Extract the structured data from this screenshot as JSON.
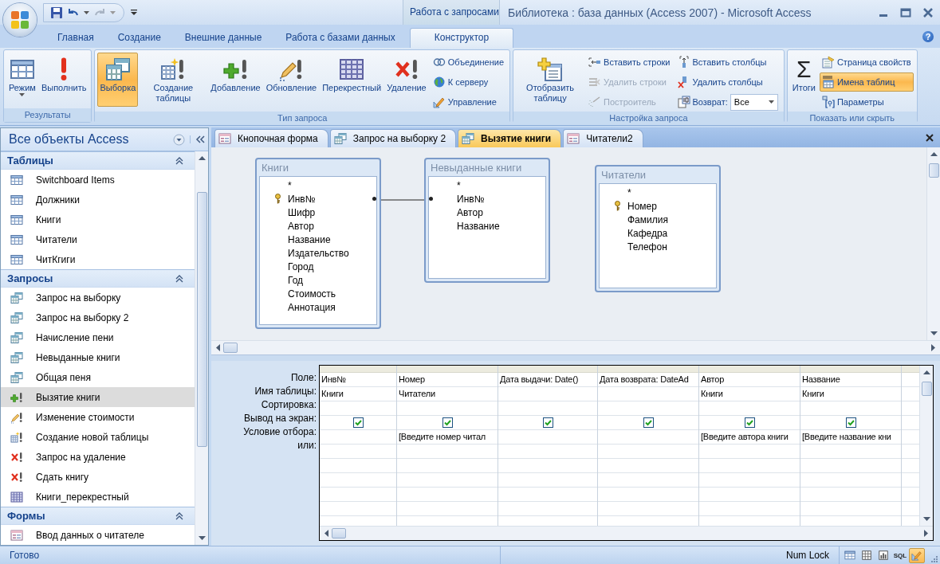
{
  "window": {
    "title": "Библиотека : база данных (Access 2007) - Microsoft Access",
    "context_tab_group": "Работа с запросами",
    "help_symbol": "?"
  },
  "ribbon_tabs": [
    {
      "label": "Главная",
      "selected": false
    },
    {
      "label": "Создание",
      "selected": false
    },
    {
      "label": "Внешние данные",
      "selected": false
    },
    {
      "label": "Работа с базами данных",
      "selected": false
    },
    {
      "label": "Конструктор",
      "selected": true
    }
  ],
  "ribbon_groups": [
    {
      "label": "Результаты",
      "items": [
        {
          "kind": "large",
          "label": "Режим",
          "dropdown": true
        },
        {
          "kind": "large",
          "label": "Выполнить"
        }
      ]
    },
    {
      "label": "Тип запроса",
      "items": [
        {
          "kind": "large",
          "label": "Выборка",
          "selected": true
        },
        {
          "kind": "large",
          "label": "Создание таблицы",
          "selected": false
        },
        {
          "kind": "large",
          "label": "Добавление",
          "selected": false
        },
        {
          "kind": "large",
          "label": "Обновление",
          "selected": false
        },
        {
          "kind": "large",
          "label": "Перекрестный",
          "selected": false
        },
        {
          "kind": "large",
          "label": "Удаление",
          "selected": false
        },
        {
          "kind": "small",
          "label": "Объединение",
          "selected": false
        },
        {
          "kind": "small",
          "label": "К серверу",
          "selected": false
        },
        {
          "kind": "small",
          "label": "Управление",
          "selected": false
        }
      ]
    },
    {
      "label": "Настройка запроса",
      "items": [
        {
          "kind": "large",
          "label": "Отобразить таблицу",
          "disabled": false
        },
        {
          "kind": "small",
          "label": "Вставить строки",
          "disabled": false
        },
        {
          "kind": "small",
          "label": "Удалить строки",
          "disabled": true
        },
        {
          "kind": "small",
          "label": "Построитель",
          "disabled": true
        },
        {
          "kind": "small",
          "label": "Вставить столбцы",
          "disabled": false
        },
        {
          "kind": "small",
          "label": "Удалить столбцы",
          "disabled": false
        },
        {
          "kind": "combo",
          "label": "Возврат:",
          "value": "Все",
          "disabled": false
        }
      ]
    },
    {
      "label": "Показать или скрыть",
      "items": [
        {
          "kind": "large",
          "label": "Итоги",
          "symbol": "Σ",
          "on": false
        },
        {
          "kind": "small",
          "label": "Страница свойств",
          "on": false
        },
        {
          "kind": "small",
          "label": "Имена таблиц",
          "on": true
        },
        {
          "kind": "small",
          "label": "Параметры",
          "on": false
        }
      ]
    }
  ],
  "nav_pane": {
    "title": "Все объекты Access",
    "groups": [
      {
        "label": "Таблицы",
        "expanded": true,
        "items": [
          {
            "kind": "table",
            "label": "Switchboard Items",
            "selected": false
          },
          {
            "kind": "table",
            "label": "Должники",
            "selected": false
          },
          {
            "kind": "table",
            "label": "Книги",
            "selected": false
          },
          {
            "kind": "table",
            "label": "Читатели",
            "selected": false
          },
          {
            "kind": "table",
            "label": "ЧитКгиги",
            "selected": false
          }
        ]
      },
      {
        "label": "Запросы",
        "expanded": true,
        "items": [
          {
            "kind": "select",
            "label": "Запрос на выборку",
            "selected": false
          },
          {
            "kind": "select",
            "label": "Запрос на выборку 2",
            "selected": false
          },
          {
            "kind": "select",
            "label": "Начисление пени",
            "selected": false
          },
          {
            "kind": "select",
            "label": "Невыданные книги",
            "selected": false
          },
          {
            "kind": "select",
            "label": "Общая пеня",
            "selected": false
          },
          {
            "kind": "append",
            "label": "Вызятие книги",
            "selected": true
          },
          {
            "kind": "update",
            "label": "Изменение стоимости",
            "selected": false
          },
          {
            "kind": "maketable",
            "label": "Создание новой таблицы",
            "selected": false
          },
          {
            "kind": "delete",
            "label": "Запрос на удаление",
            "selected": false
          },
          {
            "kind": "delete",
            "label": "Сдать книгу",
            "selected": false
          },
          {
            "kind": "crosstab",
            "label": "Книги_перекрестный",
            "selected": false
          }
        ]
      },
      {
        "label": "Формы",
        "expanded": true,
        "items": [
          {
            "kind": "form",
            "label": "Ввод данных о читателе",
            "selected": false
          }
        ]
      }
    ]
  },
  "document_tabs": [
    {
      "kind": "form",
      "label": "Кнопочная форма",
      "selected": false
    },
    {
      "kind": "query",
      "label": "Запрос на выборку 2",
      "selected": false
    },
    {
      "kind": "query",
      "label": "Вызятие книги",
      "selected": true
    },
    {
      "kind": "form",
      "label": "Читатели2",
      "selected": false
    }
  ],
  "query_tables": [
    {
      "title": "Книги",
      "fields": [
        {
          "name": "*",
          "key": false,
          "join": false
        },
        {
          "name": "Инв№",
          "key": true,
          "join": true
        },
        {
          "name": "Шифр",
          "key": false,
          "join": false
        },
        {
          "name": "Автор",
          "key": false,
          "join": false
        },
        {
          "name": "Название",
          "key": false,
          "join": false
        },
        {
          "name": "Издательство",
          "key": false,
          "join": false
        },
        {
          "name": "Город",
          "key": false,
          "join": false
        },
        {
          "name": "Год",
          "key": false,
          "join": false
        },
        {
          "name": "Стоимость",
          "key": false,
          "join": false
        },
        {
          "name": "Аннотация",
          "key": false,
          "join": false
        }
      ]
    },
    {
      "title": "Невыданные книги",
      "fields": [
        {
          "name": "*",
          "key": false,
          "join": false
        },
        {
          "name": "Инв№",
          "key": false,
          "join": true
        },
        {
          "name": "Автор",
          "key": false,
          "join": false
        },
        {
          "name": "Название",
          "key": false,
          "join": false
        }
      ]
    },
    {
      "title": "Читатели",
      "fields": [
        {
          "name": "*",
          "key": false,
          "join": false
        },
        {
          "name": "Номер",
          "key": true,
          "join": false
        },
        {
          "name": "Фамилия",
          "key": false,
          "join": false
        },
        {
          "name": "Кафедра",
          "key": false,
          "join": false
        },
        {
          "name": "Телефон",
          "key": false,
          "join": false
        }
      ]
    }
  ],
  "design_grid": {
    "row_labels": [
      "Поле:",
      "Имя таблицы:",
      "Сортировка:",
      "Вывод на экран:",
      "Условие отбора:",
      "или:"
    ],
    "columns": [
      {
        "field": "Инв№",
        "table": "Книги",
        "show": true
      },
      {
        "field": "Номер",
        "table": "Читатели",
        "show": true,
        "criteria": "[Введите номер читал"
      },
      {
        "field": "Дата выдачи: Date()",
        "show": true
      },
      {
        "field": "Дата возврата: DateAd",
        "show": true
      },
      {
        "field": "Автор",
        "table": "Книги",
        "show": true,
        "criteria": "[Введите автора книги"
      },
      {
        "field": "Название",
        "table": "Книги",
        "show": true,
        "criteria": "[Введите название кни"
      }
    ]
  },
  "status_bar": {
    "status": "Готово",
    "indicator": "Num Lock",
    "views": [
      {
        "kind": "datasheet",
        "selected": false
      },
      {
        "kind": "pivottable",
        "selected": false
      },
      {
        "kind": "pivotchart",
        "selected": false
      },
      {
        "kind": "sql",
        "label": "SQL",
        "selected": false
      },
      {
        "kind": "design",
        "selected": true
      }
    ]
  }
}
